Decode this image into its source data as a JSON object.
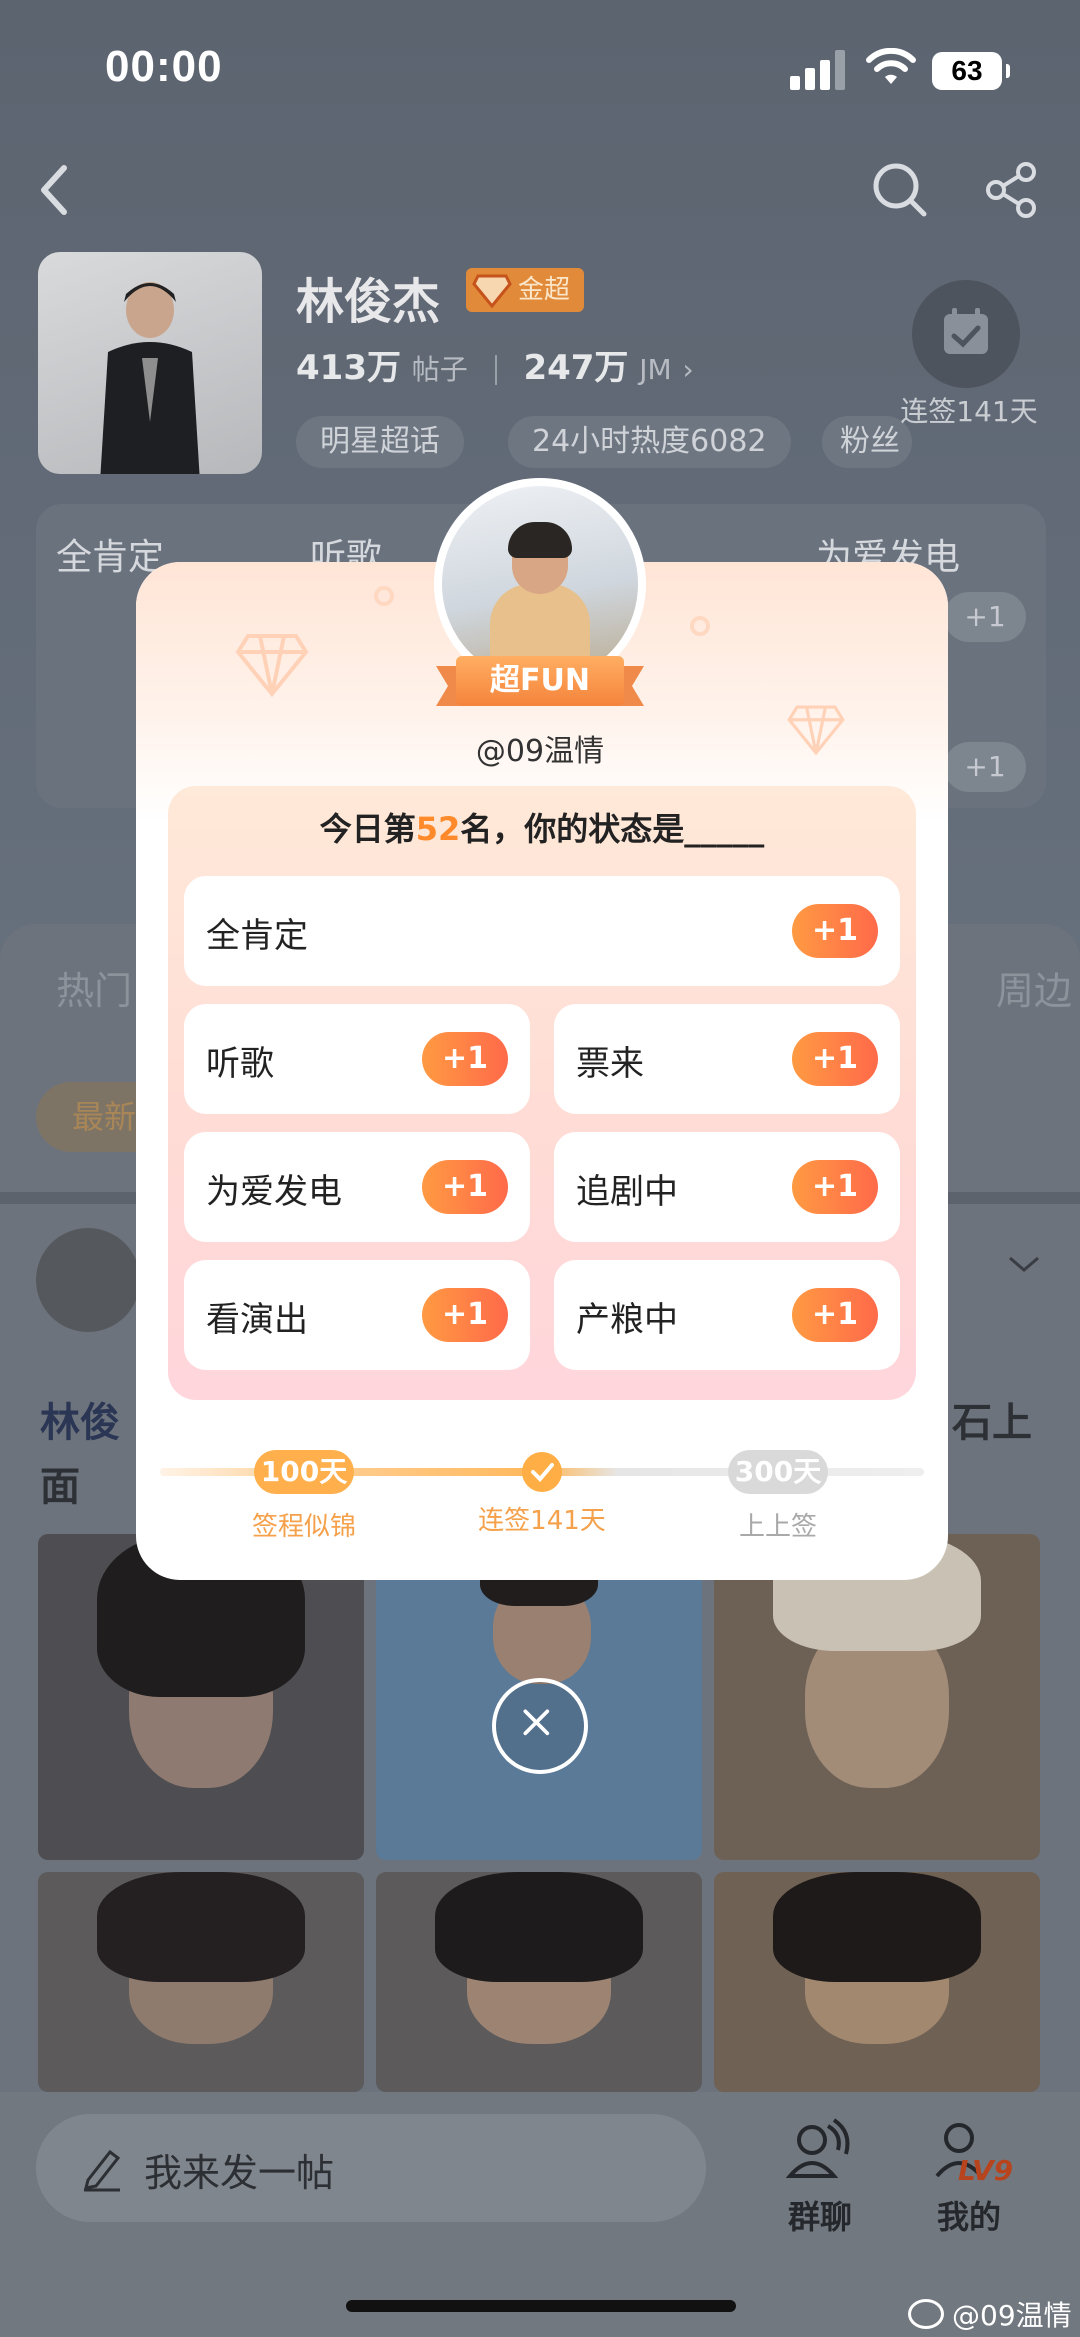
{
  "status_bar": {
    "time": "00:00",
    "battery": "63"
  },
  "header": {
    "star_name": "林俊杰",
    "badge": "金超",
    "posts_count": "413万",
    "posts_label": "帖子",
    "fans_count": "247万",
    "fans_label": "JM",
    "chips": [
      "明星超话",
      "24小时热度6082",
      "粉丝"
    ],
    "checkin_label": "连签141天"
  },
  "bg_card": {
    "items": [
      "全肯定",
      "听歌",
      "为爱发电"
    ],
    "plus": "+1"
  },
  "tabs": {
    "left": "热门",
    "right": "周边"
  },
  "newest_pill": "最新",
  "bg_post": {
    "title_start": "林俊",
    "title_end": "石上",
    "line2": "面"
  },
  "modal": {
    "ribbon": "超FUN",
    "handle": "@09温情",
    "question_prefix": "今日第",
    "rank": "52",
    "question_suffix": "名，你的状态是_____",
    "options": [
      {
        "label": "全肯定",
        "plus": "+1"
      },
      {
        "label": "听歌",
        "plus": "+1"
      },
      {
        "label": "票来",
        "plus": "+1"
      },
      {
        "label": "为爱发电",
        "plus": "+1"
      },
      {
        "label": "追剧中",
        "plus": "+1"
      },
      {
        "label": "看演出",
        "plus": "+1"
      },
      {
        "label": "产粮中",
        "plus": "+1"
      }
    ],
    "progress": {
      "milestone_1_pill": "100天",
      "milestone_1_label": "签程似锦",
      "current_label": "连签141天",
      "milestone_2_pill": "300天",
      "milestone_2_label": "上上签"
    }
  },
  "bottom": {
    "post_placeholder": "我来发一帖",
    "group_chat": "群聊",
    "mine": "我的",
    "level": "LV9"
  },
  "watermark": "@09温情",
  "colors": {
    "accent": "#ff8a2b",
    "plus_start": "#ff9a42",
    "plus_end": "#ff6a4a"
  }
}
